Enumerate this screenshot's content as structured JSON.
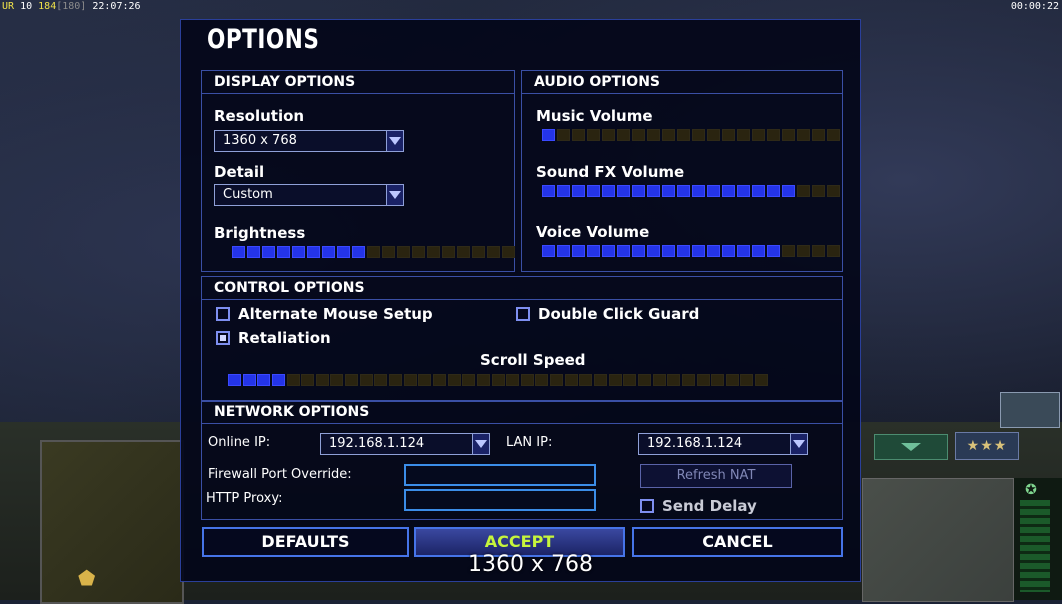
{
  "hud": {
    "top_left": {
      "ur": "UR",
      "num1": "10",
      "num2": "184",
      "num3": "[180]",
      "time": "22:07:26"
    },
    "top_right_time": "00:00:22",
    "stars": "★★★"
  },
  "dialog": {
    "title": "OPTIONS",
    "display": {
      "header": "DISPLAY OPTIONS",
      "resolution_label": "Resolution",
      "resolution_value": "1360 x 768",
      "detail_label": "Detail",
      "detail_value": "Custom",
      "brightness_label": "Brightness",
      "brightness_level": 9,
      "brightness_total": 19
    },
    "audio": {
      "header": "AUDIO OPTIONS",
      "music_label": "Music Volume",
      "music_level": 1,
      "music_total": 20,
      "sfx_label": "Sound FX Volume",
      "sfx_level": 17,
      "sfx_total": 20,
      "voice_label": "Voice Volume",
      "voice_level": 16,
      "voice_total": 20
    },
    "control": {
      "header": "CONTROL OPTIONS",
      "alternate_mouse_label": "Alternate Mouse Setup",
      "alternate_mouse_checked": false,
      "double_click_label": "Double Click Guard",
      "double_click_checked": false,
      "retaliation_label": "Retaliation",
      "retaliation_checked": true,
      "scroll_speed_label": "Scroll Speed",
      "scroll_level": 4,
      "scroll_total": 37
    },
    "network": {
      "header": "NETWORK OPTIONS",
      "online_ip_label": "Online IP:",
      "online_ip_value": "192.168.1.124",
      "lan_ip_label": "LAN IP:",
      "lan_ip_value": "192.168.1.124",
      "firewall_label": "Firewall Port Override:",
      "firewall_value": "",
      "http_proxy_label": "HTTP Proxy:",
      "http_proxy_value": "",
      "refresh_nat_label": "Refresh NAT",
      "send_delay_label": "Send Delay",
      "send_delay_checked": false
    },
    "buttons": {
      "defaults": "DEFAULTS",
      "accept": "ACCEPT",
      "cancel": "CANCEL"
    }
  },
  "tooltip": "1360 x 768"
}
